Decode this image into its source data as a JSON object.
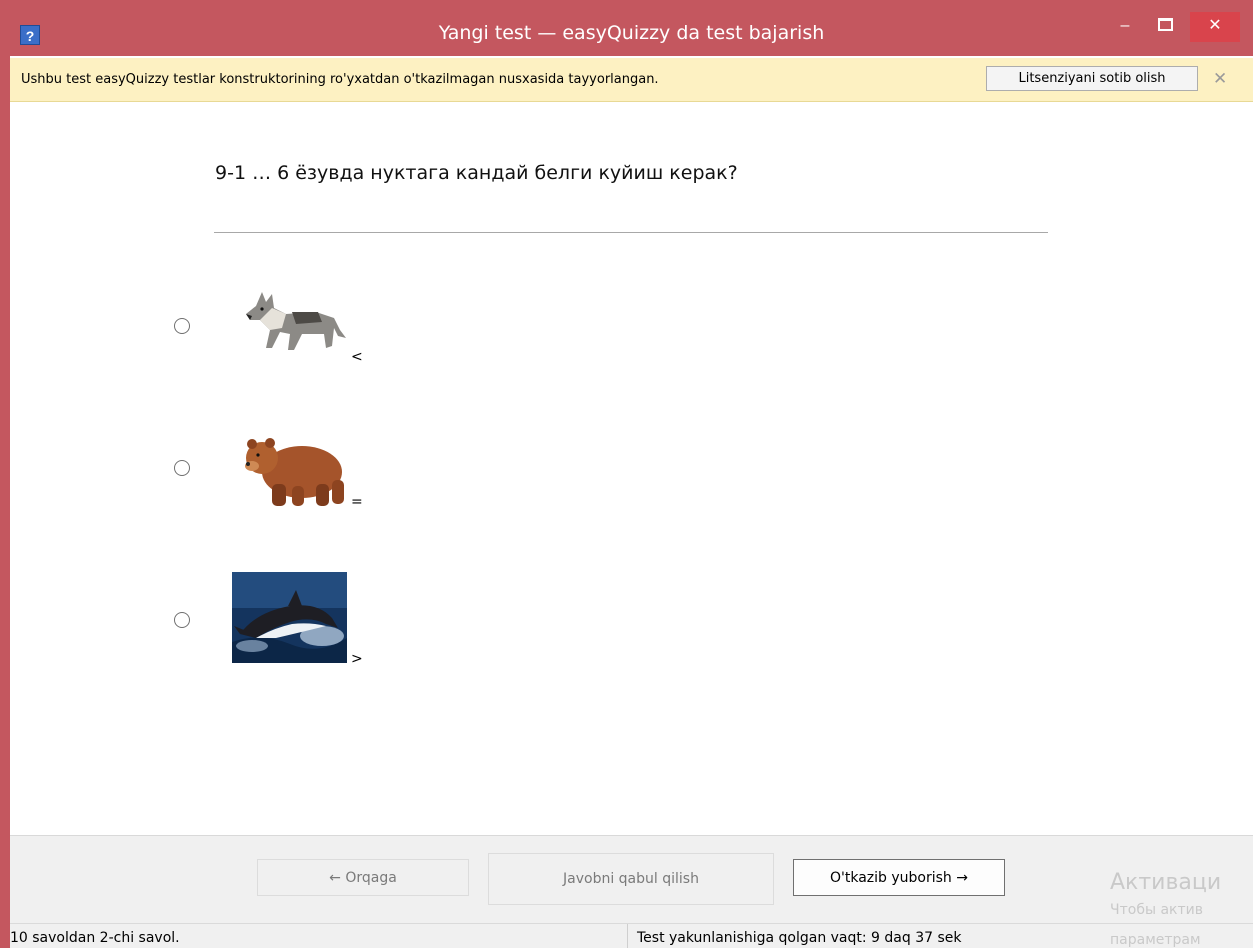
{
  "window": {
    "title": "Yangi test — easyQuizzy da test bajarish",
    "help_icon": "?",
    "minimize": "–",
    "close": "✕"
  },
  "infobar": {
    "text": "Ushbu test easyQuizzy testlar konstruktorining ro'yxatdan o'tkazilmagan nusxasida tayyorlangan.",
    "button": "Litsenziyani sotib olish",
    "close": "✕"
  },
  "question": {
    "text": "9-1 … 6 ёзувда  нуктага кандай белги куйиш керак?"
  },
  "options": [
    {
      "image": "wolf-image",
      "label": "<"
    },
    {
      "image": "bear-image",
      "label": "="
    },
    {
      "image": "dolphin-image",
      "label": ">"
    }
  ],
  "footer": {
    "back": "← Orqaga",
    "accept": "Javobni qabul qilish",
    "skip": "O'tkazib yuborish →"
  },
  "status": {
    "progress": "10 savoldan 2-chi savol.",
    "time_left": "Test yakunlanishiga qolgan vaqt: 9 daq 37 sek"
  },
  "watermark": {
    "line1": "Активаци",
    "line2": "Чтобы актив",
    "line3": "параметрам"
  }
}
